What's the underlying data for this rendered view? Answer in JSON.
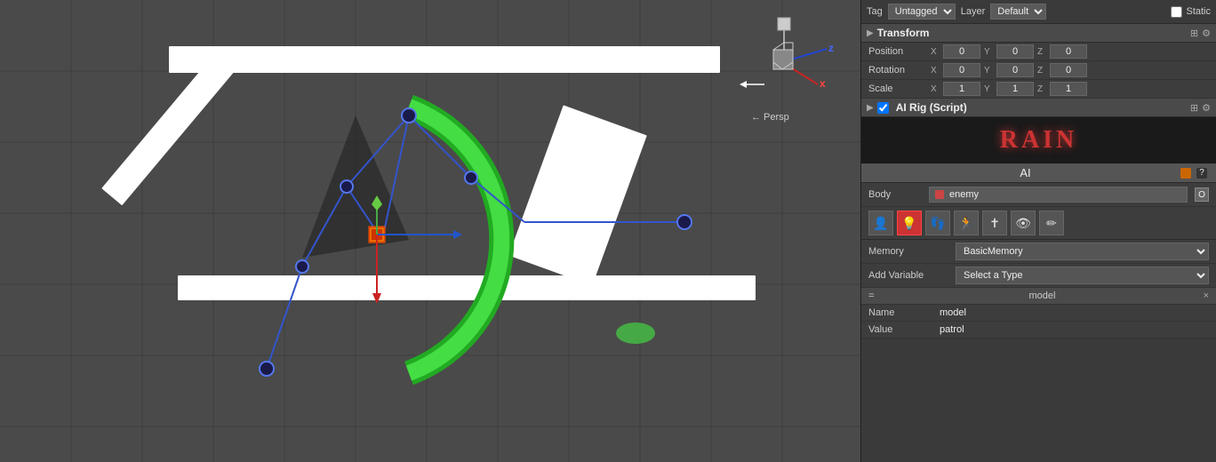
{
  "viewport": {
    "persp_label": "← Persp"
  },
  "panel": {
    "tag_label": "Tag",
    "tag_value": "Untagged",
    "layer_label": "Layer",
    "layer_value": "Default",
    "static_label": "Static",
    "transform": {
      "title": "Transform",
      "position": {
        "label": "Position",
        "x": "0",
        "y": "0",
        "z": "0"
      },
      "rotation": {
        "label": "Rotation",
        "x": "0",
        "y": "0",
        "z": "0"
      },
      "scale": {
        "label": "Scale",
        "x": "1",
        "y": "1",
        "z": "1"
      }
    },
    "ai_rig": {
      "title": "AI Rig (Script)",
      "rain_logo": "RAIN",
      "ai_label": "AI",
      "body_label": "Body",
      "body_value": "enemy",
      "body_o": "O",
      "memory_label": "Memory",
      "memory_value": "BasicMemory",
      "add_variable_label": "Add Variable",
      "add_variable_placeholder": "Select a Type",
      "var_header_equals": "=",
      "var_header_name": "model",
      "var_close": "×",
      "name_label": "Name",
      "name_value": "model",
      "value_label": "Value",
      "value_value": "patrol"
    },
    "icons": {
      "fold_arrow": "▶",
      "settings": "⚙",
      "layout": "⊞",
      "question": "?",
      "color_orange": "#cc6600",
      "color_red": "#cc3333"
    }
  }
}
